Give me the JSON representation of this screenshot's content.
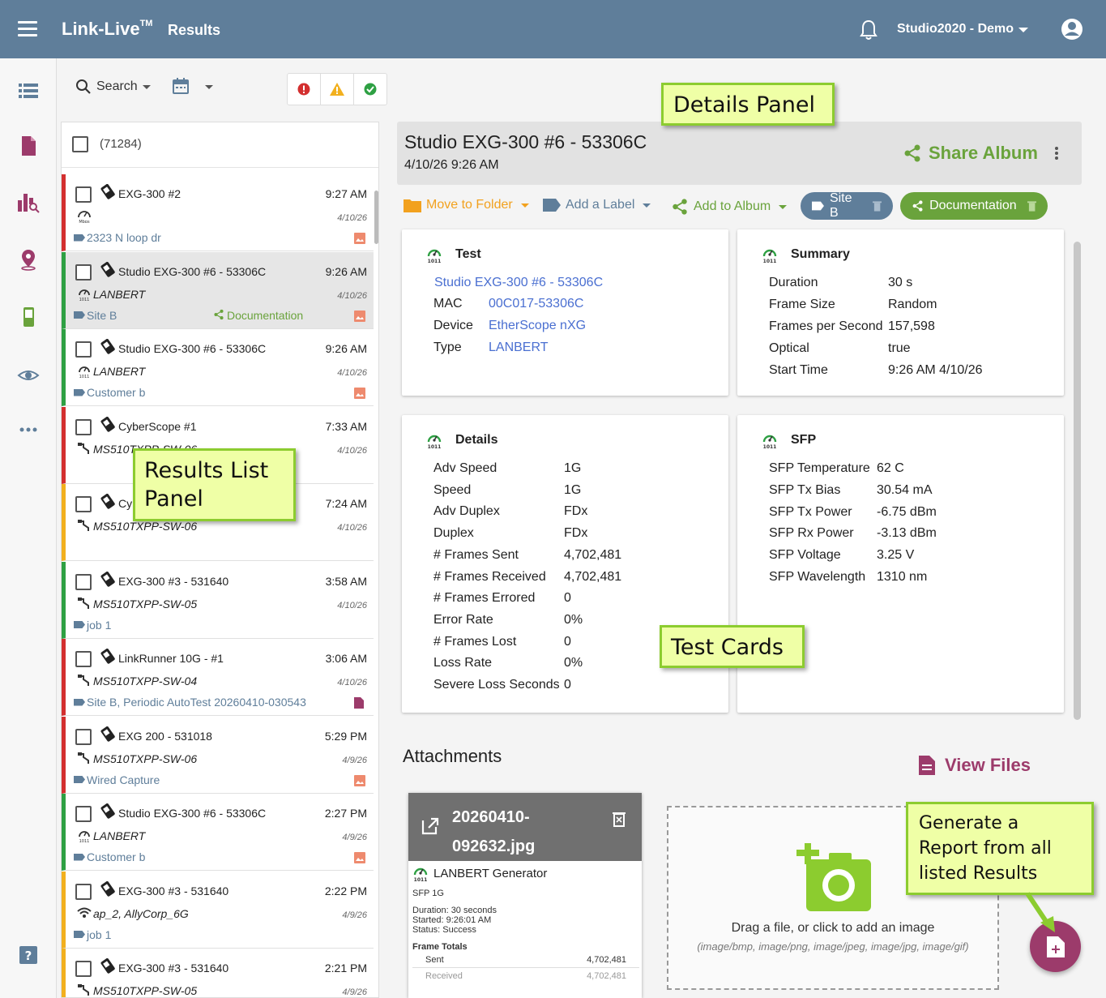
{
  "app": {
    "brand": "Link-Live",
    "brand_tm": "TM",
    "section": "Results",
    "account": "Studio2020 - Demo"
  },
  "toolbar": {
    "search_label": "Search"
  },
  "list": {
    "count": "(71284)",
    "rows": [
      {
        "status": "red",
        "name": "EXG-300 #2",
        "time": "9:27 AM",
        "sub": "",
        "date": "4/10/26",
        "tag": "2323 N loop dr",
        "album": "",
        "attachment": "image",
        "sub_icon": "speed"
      },
      {
        "status": "green",
        "name": "Studio EXG-300 #6 - 53306C",
        "time": "9:26 AM",
        "sub": "LANBERT",
        "date": "4/10/26",
        "tag": "Site B",
        "album": "Documentation",
        "attachment": "image",
        "sub_icon": "gauge",
        "selected": true
      },
      {
        "status": "green",
        "name": "Studio EXG-300 #6 - 53306C",
        "time": "9:26 AM",
        "sub": "LANBERT",
        "date": "4/10/26",
        "tag": "Customer b",
        "album": "",
        "attachment": "image",
        "sub_icon": "gauge"
      },
      {
        "status": "red",
        "name": "CyberScope #1",
        "time": "7:33 AM",
        "sub": "MS510TXPP-SW-06",
        "date": "4/10/26",
        "tag": "",
        "album": "",
        "attachment": "",
        "sub_icon": "cable"
      },
      {
        "status": "yellow",
        "name": "CyberScope #1",
        "time": "7:24 AM",
        "sub": "MS510TXPP-SW-06",
        "date": "4/10/26",
        "tag": "",
        "album": "",
        "attachment": "",
        "sub_icon": "cable"
      },
      {
        "status": "green",
        "name": "EXG-300 #3 - 531640",
        "time": "3:58 AM",
        "sub": "MS510TXPP-SW-05",
        "date": "4/10/26",
        "tag": "job 1",
        "album": "",
        "attachment": "",
        "sub_icon": "cable"
      },
      {
        "status": "red",
        "name": "LinkRunner 10G - #1",
        "time": "3:06 AM",
        "sub": "MS510TXPP-SW-04",
        "date": "4/10/26",
        "tag": "Site B, Periodic AutoTest 20260410-030543",
        "album": "",
        "attachment": "doc",
        "sub_icon": "cable"
      },
      {
        "status": "red",
        "name": "EXG 200 - 531018",
        "time": "5:29 PM",
        "sub": "MS510TXPP-SW-06",
        "date": "4/9/26",
        "tag": "Wired Capture",
        "album": "",
        "attachment": "image",
        "sub_icon": "cable"
      },
      {
        "status": "green",
        "name": "Studio EXG-300 #6 - 53306C",
        "time": "2:27 PM",
        "sub": "LANBERT",
        "date": "4/9/26",
        "tag": "Customer b",
        "album": "",
        "attachment": "image",
        "sub_icon": "gauge"
      },
      {
        "status": "yellow",
        "name": "EXG-300 #3 - 531640",
        "time": "2:22 PM",
        "sub": "ap_2, AllyCorp_6G",
        "date": "4/9/26",
        "tag": "job 1",
        "album": "",
        "attachment": "",
        "sub_icon": "wifi"
      },
      {
        "status": "yellow",
        "name": "EXG-300 #3 - 531640",
        "time": "2:21 PM",
        "sub": "MS510TXPP-SW-05",
        "date": "4/9/26",
        "tag": "",
        "album": "",
        "attachment": "",
        "sub_icon": "cable"
      }
    ]
  },
  "details": {
    "title": "Studio EXG-300 #6 - 53306C",
    "datetime": "4/10/26 9:26 AM",
    "share_album": "Share Album",
    "actions": {
      "move_to_folder": "Move to Folder",
      "add_label": "Add a Label",
      "add_to_album": "Add to Album",
      "label_pill": "Site B",
      "album_pill": "Documentation"
    },
    "test_card": {
      "title": "Test",
      "name_link": "Studio EXG-300 #6 - 53306C",
      "rows": [
        {
          "k": "MAC",
          "v": "00C017-53306C"
        },
        {
          "k": "Device",
          "v": "EtherScope nXG"
        },
        {
          "k": "Type",
          "v": "LANBERT"
        }
      ]
    },
    "summary_card": {
      "title": "Summary",
      "rows": [
        {
          "k": "Duration",
          "v": "30 s"
        },
        {
          "k": "Frame Size",
          "v": "Random"
        },
        {
          "k": "Frames per Second",
          "v": "157,598"
        },
        {
          "k": "Optical",
          "v": "true"
        },
        {
          "k": "Start Time",
          "v": "9:26 AM 4/10/26"
        }
      ]
    },
    "details_card": {
      "title": "Details",
      "rows": [
        {
          "k": "Adv Speed",
          "v": "1G"
        },
        {
          "k": "Speed",
          "v": "1G"
        },
        {
          "k": "Adv Duplex",
          "v": "FDx"
        },
        {
          "k": "Duplex",
          "v": "FDx"
        },
        {
          "k": "# Frames Sent",
          "v": "4,702,481"
        },
        {
          "k": "# Frames Received",
          "v": "4,702,481"
        },
        {
          "k": "# Frames Errored",
          "v": "0"
        },
        {
          "k": "Error Rate",
          "v": "0%"
        },
        {
          "k": "# Frames Lost",
          "v": "0"
        },
        {
          "k": "Loss Rate",
          "v": "0%"
        },
        {
          "k": "Severe Loss Seconds",
          "v": "0"
        }
      ]
    },
    "sfp_card": {
      "title": "SFP",
      "rows": [
        {
          "k": "SFP Temperature",
          "v": "62 C"
        },
        {
          "k": "SFP Tx Bias",
          "v": "30.54 mA"
        },
        {
          "k": "SFP Tx Power",
          "v": "-6.75 dBm"
        },
        {
          "k": "SFP Rx Power",
          "v": "-3.13 dBm"
        },
        {
          "k": "SFP Voltage",
          "v": "3.25 V"
        },
        {
          "k": "SFP Wavelength",
          "v": "1310 nm"
        }
      ]
    }
  },
  "attachments": {
    "title": "Attachments",
    "view_files": "View Files",
    "file": {
      "name_line1": "20260410-",
      "name_line2": "092632.jpg",
      "preview_title": "LANBERT Generator",
      "preview_gauge_label": "1011",
      "preview_sfp": "SFP  1G",
      "preview_duration": "Duration:  30 seconds",
      "preview_started": "Started:  9:26:01 AM",
      "preview_status": "Status:  Success",
      "preview_totals": "Frame Totals",
      "preview_sent_k": "Sent",
      "preview_sent_v": "4,702,481",
      "preview_recv_k": "Received",
      "preview_recv_v": "4,702,481"
    },
    "dropzone_text": "Drag a file, or click to add an image",
    "dropzone_types": "(image/bmp, image/png, image/jpeg, image/jpg, image/gif)"
  },
  "callouts": {
    "details_panel": "Details Panel",
    "results_list_1": "Results List",
    "results_list_2": "Panel",
    "test_cards": "Test Cards",
    "generate_1": "Generate a",
    "generate_2": "Report from all",
    "generate_3": "listed Results"
  },
  "colors": {
    "topbar": "#5f7e9a",
    "green": "#2ea043",
    "red": "#d32f2f",
    "yellow": "#f2b01e",
    "album_green": "#6aa33c",
    "accent_purple": "#9c3b6b",
    "link_blue": "#4a6fd1",
    "callout_bg": "#efffa6"
  }
}
